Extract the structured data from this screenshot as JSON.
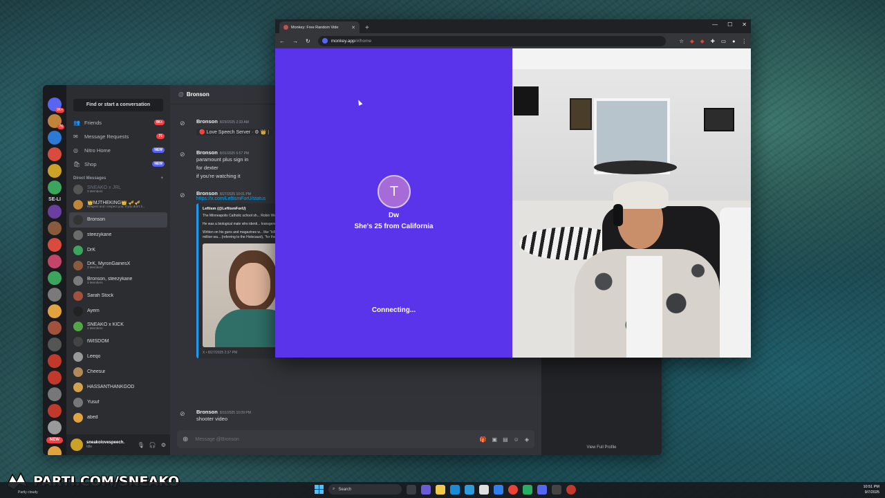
{
  "discord": {
    "search_placeholder": "Find or start a conversation",
    "nav": [
      {
        "label": "Friends",
        "icon": "friends-icon",
        "badge": "9K+"
      },
      {
        "label": "Message Requests",
        "icon": "mail-icon",
        "badge": "71"
      },
      {
        "label": "Nitro Home",
        "icon": "nitro-icon",
        "badge": "NEW"
      },
      {
        "label": "Shop",
        "icon": "shop-icon",
        "badge": "NEW"
      }
    ],
    "dm_header": "Direct Messages",
    "dm_add": "+",
    "server_badges": [
      "9K+",
      "76",
      "",
      "",
      "",
      "",
      "",
      "",
      "",
      "",
      "",
      "",
      "",
      "",
      "",
      "",
      "",
      "",
      "",
      "",
      "",
      ""
    ],
    "server_text": "SE-LI",
    "server_new": "NEW",
    "dms": [
      {
        "name": "SNEAKO x JRL",
        "sub": "3 Members",
        "dim": true,
        "color": "#555"
      },
      {
        "name": "👑MJTHEKING👑 🎺🎺",
        "sub": "Respect and I respect you, if you don't li...",
        "color": "#c0853a"
      },
      {
        "name": "Bronson",
        "sub": "",
        "active": true,
        "color": "#333"
      },
      {
        "name": "steezykane",
        "sub": "",
        "color": "#6b6b6b"
      },
      {
        "name": "DrK",
        "sub": "",
        "color": "#3ba55d"
      },
      {
        "name": "DrK, MyronGainesX",
        "sub": "3 Members",
        "color": "#8a5a3c"
      },
      {
        "name": "Bronson, steezykane",
        "sub": "3 Members",
        "color": "#7a7a7a"
      },
      {
        "name": "Sarah Stock",
        "sub": "",
        "color": "#a0523d"
      },
      {
        "name": "Ayem",
        "sub": "",
        "color": "#222"
      },
      {
        "name": "SNEAKO x KICK",
        "sub": "4 Members",
        "color": "#53a548"
      },
      {
        "name": "tWISDOM",
        "sub": "",
        "color": "#444"
      },
      {
        "name": "Leeqo",
        "sub": "",
        "color": "#999"
      },
      {
        "name": "Cheesur",
        "sub": "",
        "color": "#b08a5a"
      },
      {
        "name": "HASSANTHANKGOD",
        "sub": "",
        "color": "#d2a24c"
      },
      {
        "name": "Yusuf",
        "sub": "",
        "color": "#777"
      },
      {
        "name": "abed",
        "sub": "",
        "color": "#e0a340"
      }
    ],
    "user": {
      "name": "sneakolovespeech.",
      "status": "Idle"
    },
    "chat": {
      "channel": "Bronson",
      "messages": [
        {
          "author": "Bronson",
          "time": "8/29/2025 2:33 AM",
          "lines": [],
          "quote": "🔴 Love Speech Server · ⚙ 👑 |"
        },
        {
          "author": "Bronson",
          "time": "8/31/2025 6:57 PM",
          "lines": [
            "paramount plus sign in",
            "for dexter",
            "if you're watching it"
          ]
        },
        {
          "author": "Bronson",
          "time": "8/27/2025 10:01 PM",
          "link": "https://x.com/LeftismForU/status",
          "embed": {
            "handle": "Leftism (@LeftismForU)",
            "p1": "The Minneapolis Catholic school sh... Robin Westman.",
            "p2": "He was a biological male who identi... transgender \"woman.\"",
            "p3": "Written on his guns and magazines w... like \"kill Trump now,\" \"6 million wa... (referring to the Holocaust), \"for the...",
            "footer": "X • 8/27/2025 2:37 PM"
          }
        },
        {
          "author": "Bronson",
          "time": "8/31/2025 10:09 PM",
          "lines": [
            "shooter video"
          ]
        }
      ],
      "composer_placeholder": "Message @Bronson"
    },
    "profile": {
      "view_full": "View Full Profile"
    }
  },
  "browser": {
    "tab_title": "Monkey: Free Random Vide",
    "url_host": "monkey.app",
    "url_path": "/#/home",
    "call": {
      "avatar_letter": "T",
      "name": "Dw",
      "info_prefix": "She's ",
      "age": "25",
      "info_mid": " from ",
      "location": "California",
      "status": "Connecting..."
    }
  },
  "watermark": "PARTI.COM/SNEAKO",
  "taskbar": {
    "weather": "Partly cloudy",
    "search": "Search",
    "time": "10:51 PM",
    "date": "9/7/2025"
  },
  "colors": {
    "call_purple": "#5a34ea",
    "discord_bg": "#1e1f22",
    "accent": "#5865f2",
    "danger": "#f23f43"
  }
}
